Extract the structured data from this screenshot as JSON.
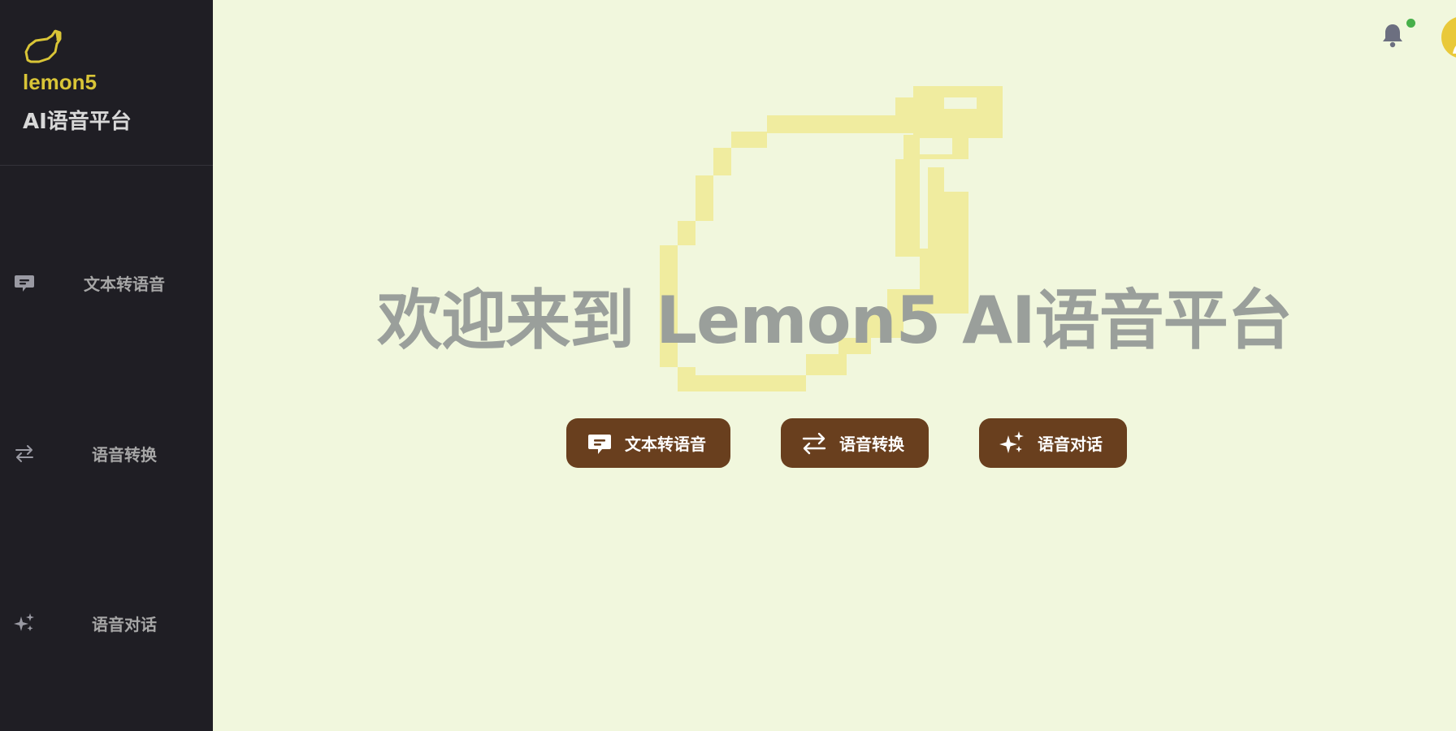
{
  "sidebar": {
    "brand": {
      "logo_icon": "lemon-icon",
      "name": "lemon5",
      "subtitle": "AI语音平台"
    },
    "items": [
      {
        "label": "文本转语音",
        "icon": "chat-bubble-icon"
      },
      {
        "label": "语音转换",
        "icon": "swap-arrows-icon"
      },
      {
        "label": "语音对话",
        "icon": "sparkles-icon"
      }
    ]
  },
  "topbar": {
    "notification_icon": "bell-icon",
    "avatar_icon": "user-avatar-icon"
  },
  "hero": {
    "title": "欢迎来到 Lemon5 AI语音平台",
    "background_icon": "lemon-icon"
  },
  "actions": [
    {
      "label": "文本转语音",
      "icon": "chat-bubble-icon"
    },
    {
      "label": "语音转换",
      "icon": "swap-arrows-icon"
    },
    {
      "label": "语音对话",
      "icon": "sparkles-icon"
    }
  ],
  "colors": {
    "sidebar_bg": "#1f1e24",
    "main_bg": "#f1f7dd",
    "brand_yellow": "#d9c537",
    "button_brown": "#693f1e",
    "title_gray": "#9a9f9b",
    "lemon_pale": "#f0ec9f",
    "status_green": "#47b04a"
  }
}
